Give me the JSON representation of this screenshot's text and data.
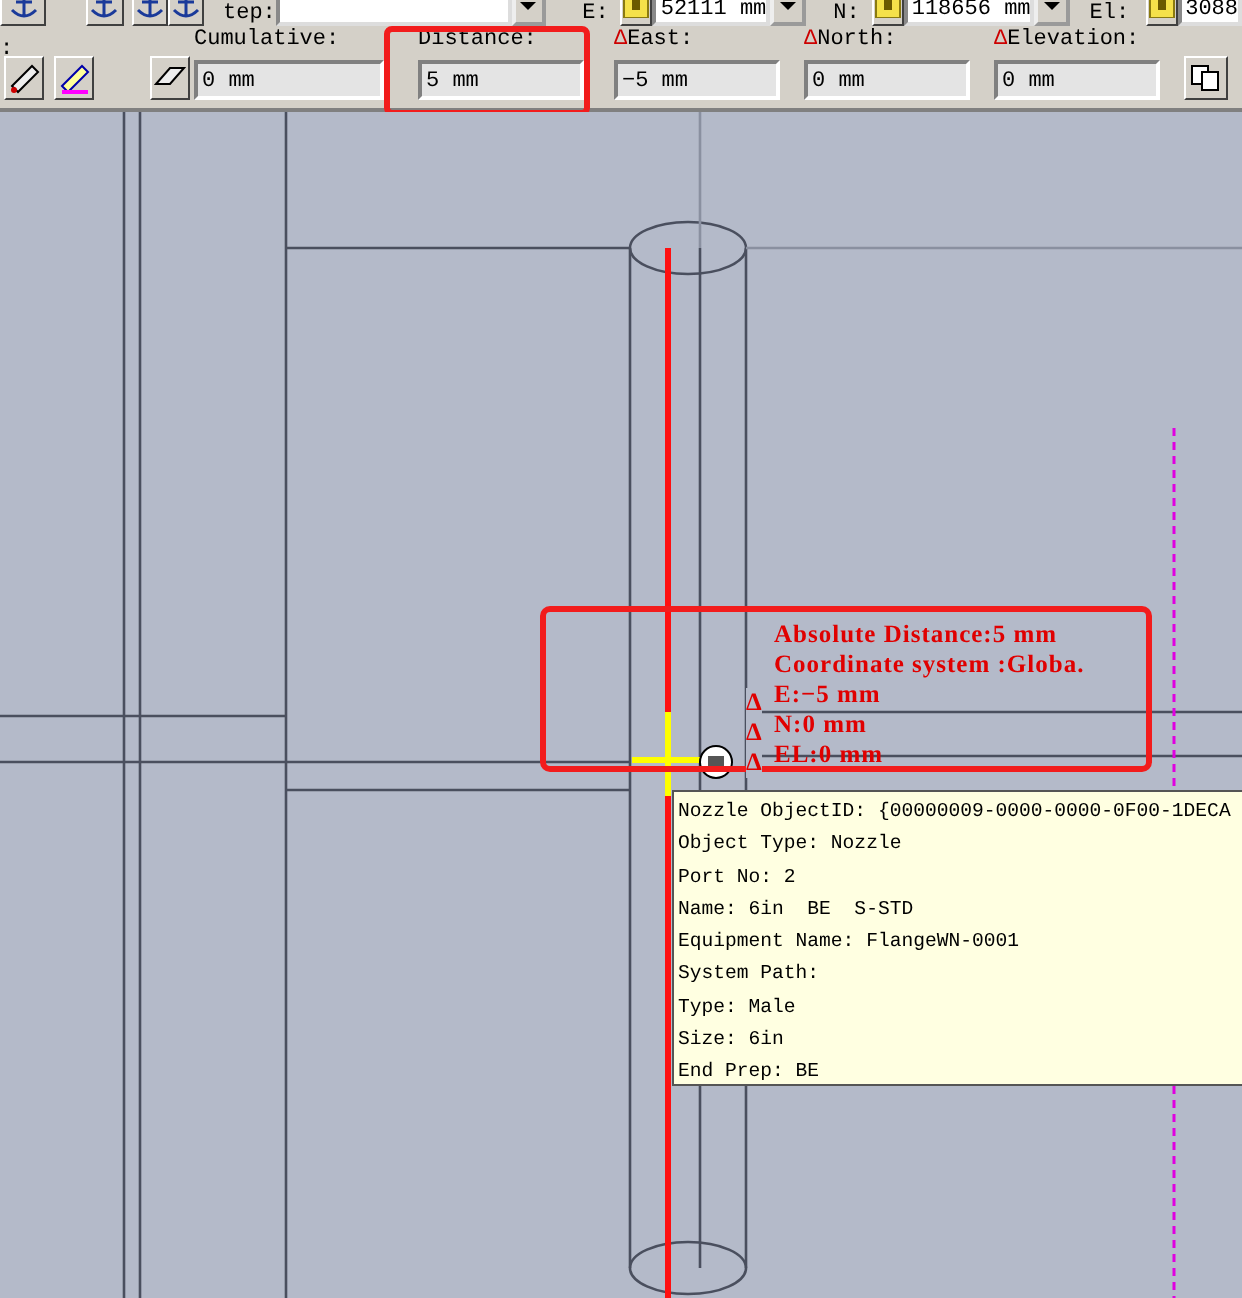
{
  "top_toolbar": {
    "step_label": "tep:",
    "east": {
      "label": "E:",
      "value": "52111 mm"
    },
    "north": {
      "label": "N:",
      "value": "118656 mm"
    },
    "elevation": {
      "label": "El:",
      "value": "3088"
    }
  },
  "measure_bar": {
    "leading_label": ":",
    "fields": [
      {
        "label": "Cumulative:",
        "value": "0 mm",
        "highlighted": false
      },
      {
        "label": "Distance:",
        "value": "5 mm",
        "highlighted": true
      },
      {
        "prefix": "Δ",
        "label": "East:",
        "value": "−5 mm",
        "highlighted": false
      },
      {
        "prefix": "Δ",
        "label": "North:",
        "value": "0 mm",
        "highlighted": false
      },
      {
        "prefix": "Δ",
        "label": "Elevation:",
        "value": "0 mm",
        "highlighted": false
      }
    ]
  },
  "measurement_readout": {
    "lines": [
      {
        "text": "Absolute Distance:5 mm"
      },
      {
        "text": "Coordinate system :Globa."
      },
      {
        "marker": "Δ",
        "text": "E:−5 mm"
      },
      {
        "marker": "Δ",
        "text": "N:0 mm"
      },
      {
        "marker": "Δ",
        "text": "EL:0 mm"
      }
    ]
  },
  "tooltip": {
    "lines": [
      "Nozzle ObjectID: {00000009-0000-0000-0F00-1DECA",
      "Object Type: Nozzle",
      "Port No: 2",
      "Name: 6in  BE  S-STD",
      "Equipment Name: FlangeWN-0001",
      "System Path:",
      "Type: Male",
      "Size: 6in",
      "End Prep: BE"
    ]
  }
}
